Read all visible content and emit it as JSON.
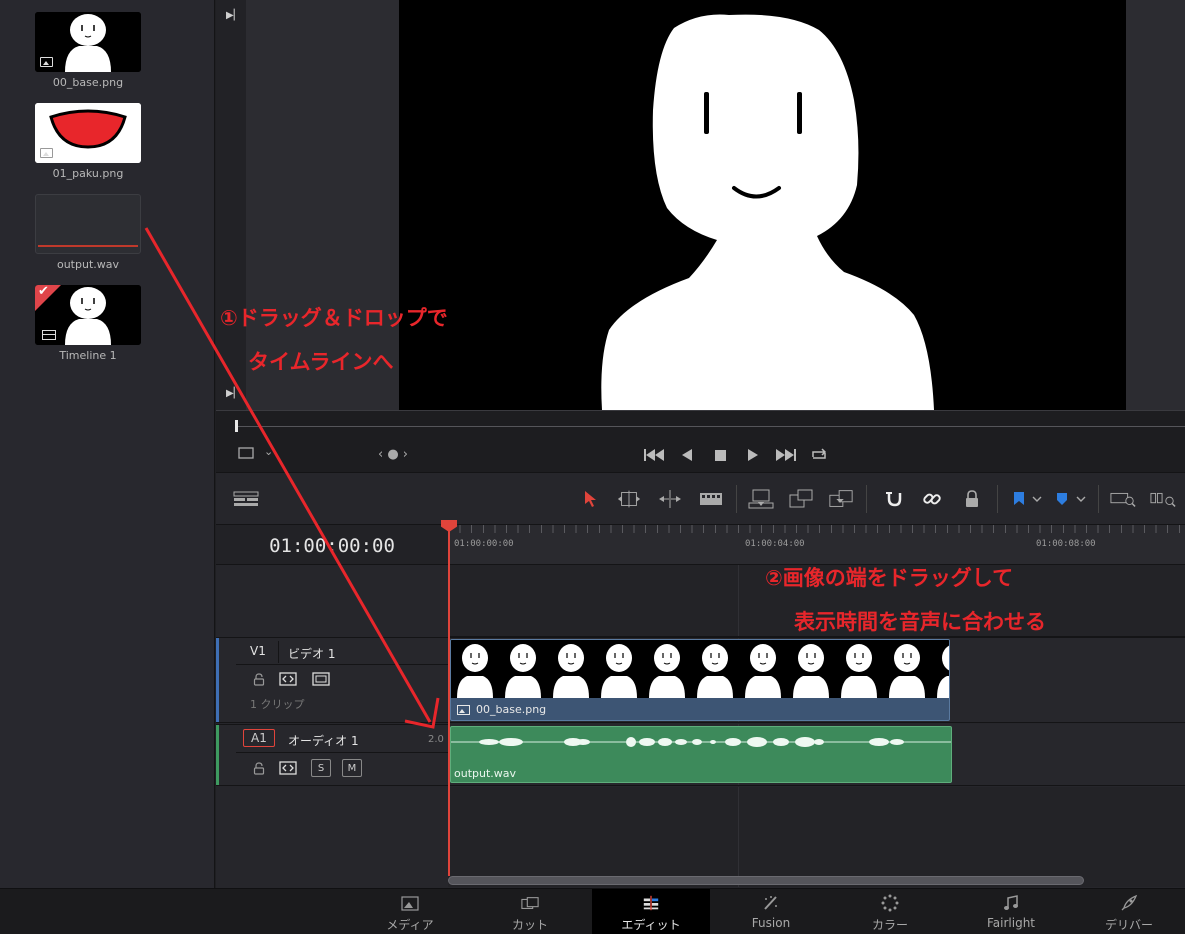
{
  "media_pool": {
    "clips": [
      {
        "name": "00_base.png"
      },
      {
        "name": "01_paku.png"
      },
      {
        "name": "output.wav"
      },
      {
        "name": "Timeline 1"
      }
    ]
  },
  "timeline": {
    "timecode": "01:00:00:00",
    "ruler": [
      "01:00:00:00",
      "01:00:04:00",
      "01:00:08:00"
    ],
    "video_track": {
      "id": "V1",
      "name": "ビデオ 1",
      "clip_count": "1 クリップ",
      "clip_name": "00_base.png"
    },
    "audio_track": {
      "id": "A1",
      "name": "オーディオ 1",
      "channels": "2.0",
      "clip_name": "output.wav",
      "solo": "S",
      "mute": "M"
    }
  },
  "pages": [
    {
      "label": "メディア",
      "icon": "media-page-icon"
    },
    {
      "label": "カット",
      "icon": "cut-page-icon"
    },
    {
      "label": "エディット",
      "icon": "edit-page-icon",
      "active": true
    },
    {
      "label": "Fusion",
      "icon": "fusion-page-icon"
    },
    {
      "label": "カラー",
      "icon": "color-page-icon"
    },
    {
      "label": "Fairlight",
      "icon": "fairlight-page-icon"
    },
    {
      "label": "デリバー",
      "icon": "deliver-page-icon"
    }
  ],
  "annotations": {
    "step1_line1": "①ドラッグ＆ドロップで",
    "step1_line2": "タイムラインへ",
    "step2_line1": "②画像の端をドラッグして",
    "step2_line2": "表示時間を音声に合わせる"
  },
  "colors": {
    "annotation": "#e8262b",
    "playhead": "#e0443b",
    "video_clip": "#3d5574",
    "audio_clip": "#3d8a5b",
    "video_track_stripe": "#3f6fb5",
    "audio_track_stripe": "#3e9a60"
  }
}
